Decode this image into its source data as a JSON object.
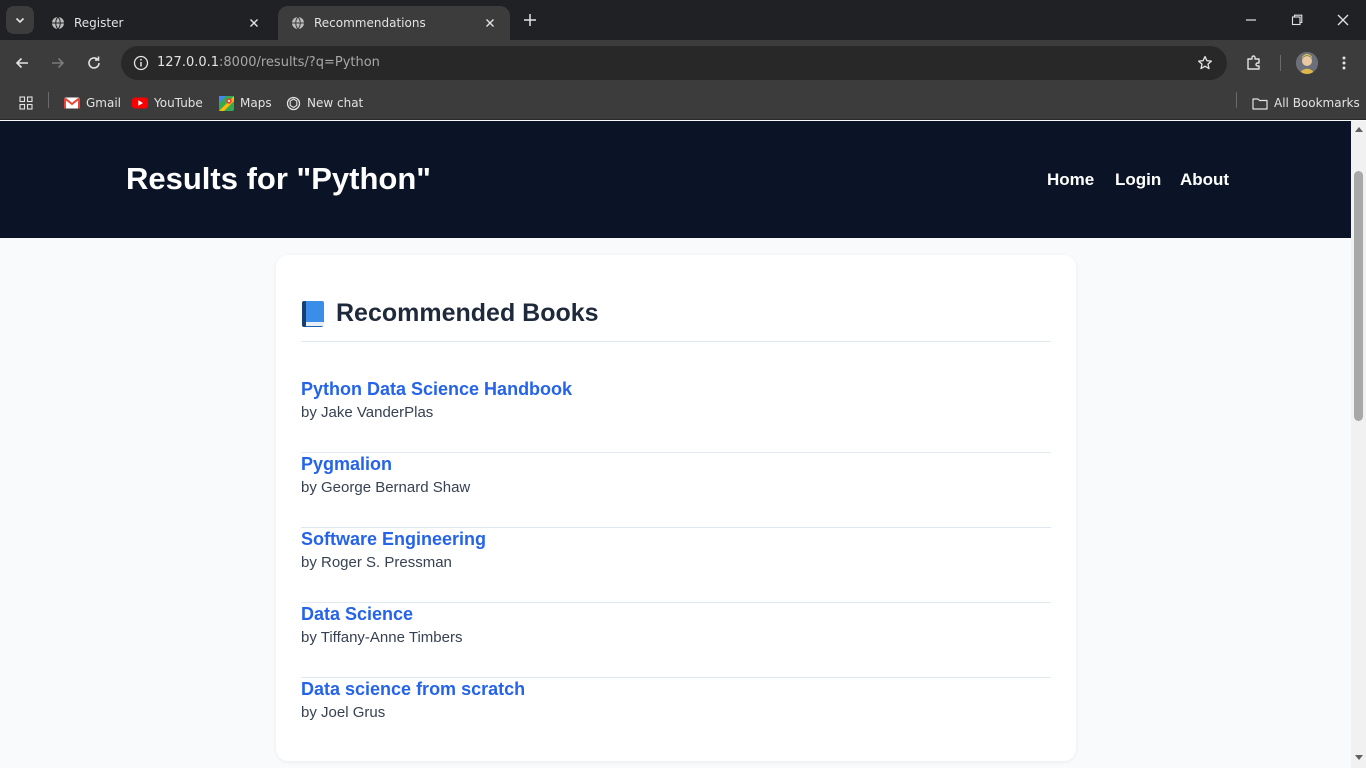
{
  "browser": {
    "tabs": [
      {
        "title": "Register",
        "active": false
      },
      {
        "title": "Recommendations",
        "active": true
      }
    ],
    "url": {
      "host": "127.0.0.1",
      "rest": ":8000/results/?q=Python"
    },
    "bookmarks": [
      {
        "label": "Gmail",
        "icon": "gmail-icon"
      },
      {
        "label": "YouTube",
        "icon": "youtube-icon"
      },
      {
        "label": "Maps",
        "icon": "maps-icon"
      },
      {
        "label": "New chat",
        "icon": "chatgpt-icon"
      }
    ],
    "all_bookmarks_label": "All Bookmarks"
  },
  "page": {
    "title": "Results for \"Python\"",
    "nav": {
      "home": "Home",
      "login": "Login",
      "about": "About"
    },
    "section_heading": "Recommended Books",
    "books": [
      {
        "title": "Python Data Science Handbook",
        "author": "by Jake VanderPlas"
      },
      {
        "title": "Pygmalion",
        "author": "by George Bernard Shaw"
      },
      {
        "title": "Software Engineering",
        "author": "by Roger S. Pressman"
      },
      {
        "title": "Data Science",
        "author": "by Tiffany-Anne Timbers"
      },
      {
        "title": "Data science from scratch",
        "author": "by Joel Grus"
      }
    ]
  },
  "colors": {
    "header_bg": "#0b1426",
    "link": "#2563eb",
    "page_bg": "#f8fafc"
  }
}
